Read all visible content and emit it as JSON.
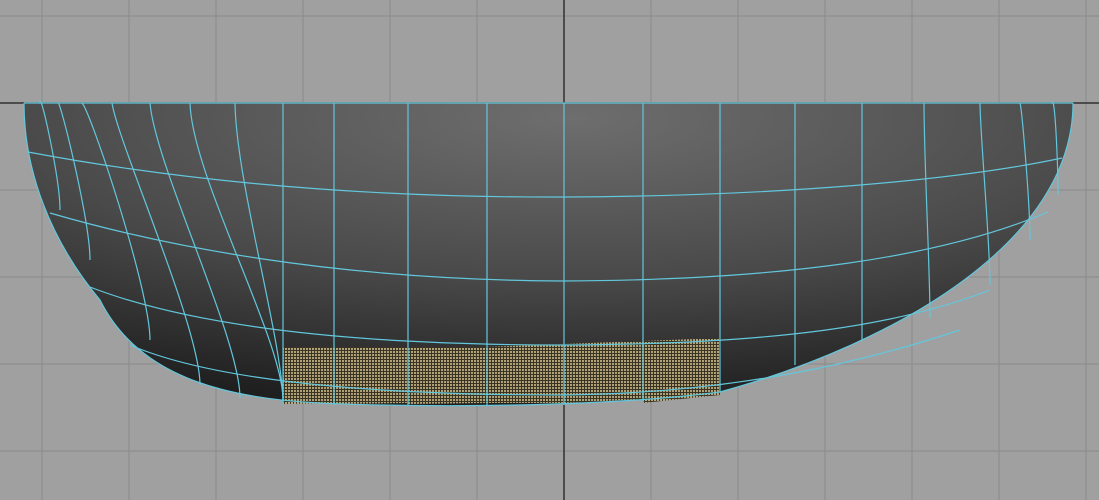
{
  "viewport": {
    "background_color": "#a0a0a0",
    "grid_color": "#8a8a8a",
    "axis_color": "#303030"
  },
  "mesh": {
    "object": "half-sphere-bowl",
    "wireframe_color": "#62c7dc",
    "shading_dark": "#1f1f1f",
    "shading_light": "#6e6e6e"
  },
  "selection": {
    "face_color": "#b8a77a",
    "selected_rows": 1,
    "selected_columns": 6
  }
}
